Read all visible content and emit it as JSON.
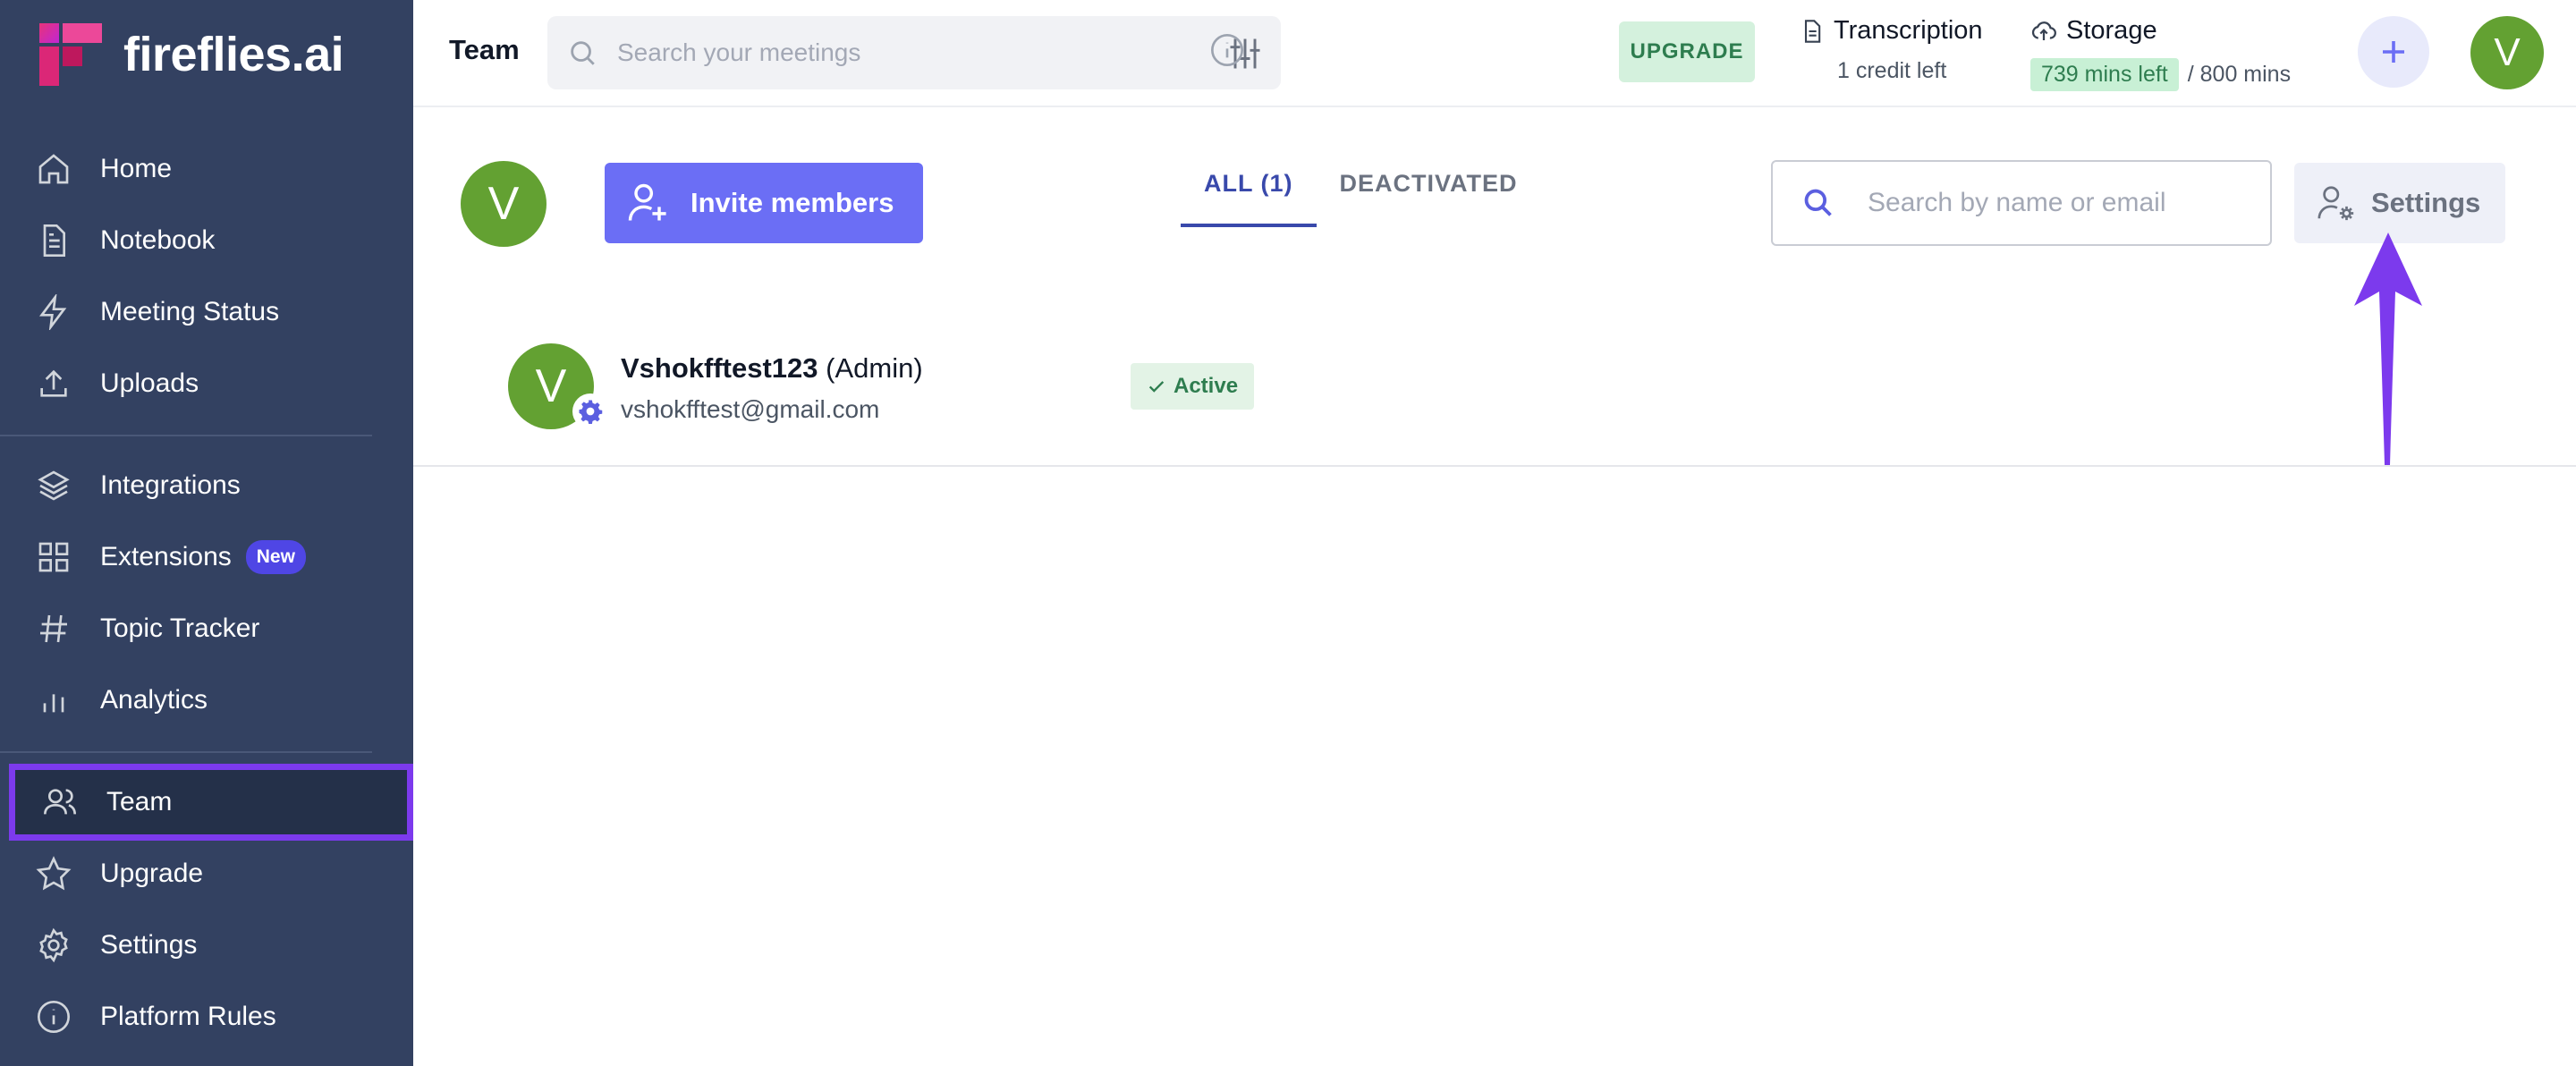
{
  "app": {
    "logo_text": "fireflies.ai"
  },
  "sidebar": {
    "items": [
      {
        "label": "Home",
        "icon": "home-icon"
      },
      {
        "label": "Notebook",
        "icon": "document-icon"
      },
      {
        "label": "Meeting Status",
        "icon": "lightning-icon"
      },
      {
        "label": "Uploads",
        "icon": "upload-icon"
      },
      {
        "label": "Integrations",
        "icon": "layers-icon"
      },
      {
        "label": "Extensions",
        "icon": "grid-icon",
        "badge": "New"
      },
      {
        "label": "Topic Tracker",
        "icon": "hash-icon"
      },
      {
        "label": "Analytics",
        "icon": "bar-chart-icon"
      },
      {
        "label": "Team",
        "icon": "users-icon",
        "active": true
      },
      {
        "label": "Upgrade",
        "icon": "star-icon"
      },
      {
        "label": "Settings",
        "icon": "gear-icon"
      },
      {
        "label": "Platform Rules",
        "icon": "info-icon"
      }
    ]
  },
  "topbar": {
    "title": "Team",
    "search_placeholder": "Search your meetings",
    "upgrade_label": "UPGRADE",
    "transcription": {
      "label": "Transcription",
      "sub": "1 credit left"
    },
    "storage": {
      "label": "Storage",
      "left": "739 mins left",
      "total": "/ 800 mins"
    },
    "avatar_initial": "V"
  },
  "team": {
    "avatar_initial": "V",
    "invite_label": "Invite members",
    "tabs": [
      {
        "label": "ALL (1)",
        "active": true
      },
      {
        "label": "DEACTIVATED",
        "active": false
      }
    ],
    "search_placeholder": "Search by name or email",
    "settings_label": "Settings",
    "members": [
      {
        "initial": "V",
        "name": "Vshokfftest123",
        "role": "(Admin)",
        "email": "vshokfftest@gmail.com",
        "status": "Active"
      }
    ]
  },
  "colors": {
    "sidebar_bg": "#334161",
    "accent": "#6b6ef5",
    "highlight": "#7c3aed",
    "avatar": "#63a132",
    "status_green": "#2e7d4f"
  }
}
